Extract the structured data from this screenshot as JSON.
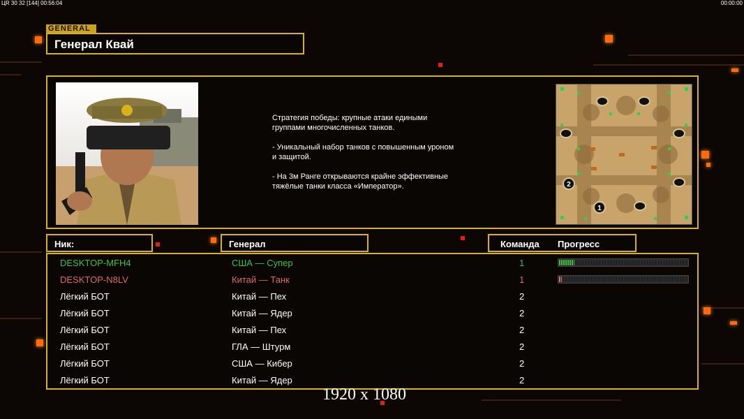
{
  "hud": {
    "left": "ЦR 30 32 [144] 00:56:04",
    "right": "00:00:00"
  },
  "header": {
    "tag": "GENERAL",
    "title": "Генерал Квай"
  },
  "general_info": {
    "description": [
      "Стратегия победы: крупные атаки едиными\n группами многочисленных танков.",
      "- Уникальный набор танков с повышенным уроном\n и защитой.",
      "- На 3м Ранге открываются крайне эффективные\n тяжёлые танки класса «Император»."
    ],
    "minimap_labels": [
      "2",
      "1"
    ]
  },
  "columns": {
    "nick": "Ник:",
    "general": "Генерал",
    "team": "Команда",
    "progress": "Прогресс"
  },
  "players": [
    {
      "nick": "DESKTOP-MFH4",
      "general": "США — Супер",
      "team": "1",
      "color": "#3cc23c",
      "progress": 0.12,
      "fill": "#3cc23c"
    },
    {
      "nick": "DESKTOP-N8LV",
      "general": "Китай — Танк",
      "team": "1",
      "color": "#e06a60",
      "progress": 0.02,
      "fill": "#e07070"
    },
    {
      "nick": "Лёгкий БОТ",
      "general": "Китай — Пех",
      "team": "2",
      "color": "#ffffff"
    },
    {
      "nick": "Лёгкий БОТ",
      "general": "Китай — Ядер",
      "team": "2",
      "color": "#ffffff"
    },
    {
      "nick": "Лёгкий БОТ",
      "general": "Китай — Пех",
      "team": "2",
      "color": "#ffffff"
    },
    {
      "nick": "Лёгкий БОТ",
      "general": "ГЛА — Штурм",
      "team": "2",
      "color": "#ffffff"
    },
    {
      "nick": "Лёгкий БОТ",
      "general": "США — Кибер",
      "team": "2",
      "color": "#ffffff"
    },
    {
      "nick": "Лёгкий БОТ",
      "general": "Китай — Ядер",
      "team": "2",
      "color": "#ffffff"
    }
  ],
  "resolution": "1920 x 1080",
  "colors": {
    "frame": "#d8b21a",
    "accent": "#ff6a10",
    "background": "#0c0704"
  }
}
